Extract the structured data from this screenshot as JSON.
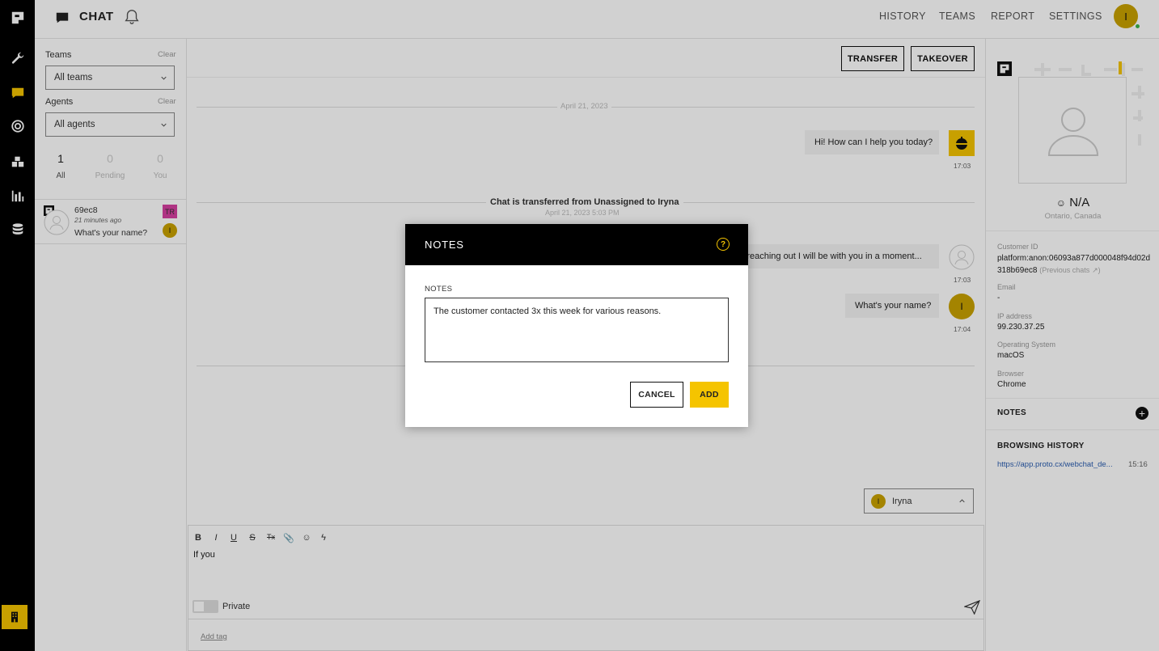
{
  "header": {
    "title": "CHAT",
    "nav": [
      "HISTORY",
      "TEAMS",
      "REPORT",
      "SETTINGS"
    ],
    "user_initial": "I"
  },
  "filters": {
    "teams_label": "Teams",
    "teams_clear": "Clear",
    "teams_value": "All teams",
    "agents_label": "Agents",
    "agents_clear": "Clear",
    "agents_value": "All agents",
    "counts": [
      {
        "value": "1",
        "label": "All"
      },
      {
        "value": "0",
        "label": "Pending"
      },
      {
        "value": "0",
        "label": "You"
      }
    ]
  },
  "chat_list": [
    {
      "name": "69ec8",
      "time": "21 minutes ago",
      "preview": "What's your name?",
      "team_badge": "TR",
      "agent_initial": "I"
    }
  ],
  "conversation": {
    "transfer_label": "TRANSFER",
    "takeover_label": "TAKEOVER",
    "date_divider": "April 21, 2023",
    "transfer_notice": "Chat is transferred from Unassigned to Iryna",
    "transfer_time": "April 21, 2023 5:03 PM",
    "messages": [
      {
        "text": "Hi! How can I help you today?",
        "time": "17:03"
      },
      {
        "text": "Thank you for reaching out I will be with you in a moment...",
        "time": "17:03"
      },
      {
        "text": "What's your name?",
        "time": "17:04"
      }
    ],
    "agent_initial": "I",
    "agent_select": "Iryna"
  },
  "composer": {
    "text": "If you",
    "private_label": "Private",
    "add_tag": "Add tag",
    "format_tools": [
      "B",
      "I",
      "U",
      "S",
      "Tx",
      "📎",
      "☺",
      "ϟ"
    ]
  },
  "customer": {
    "name": "N/A",
    "location": "Ontario, Canada",
    "customer_id_label": "Customer ID",
    "customer_id": "platform:anon:06093a877d000048f94d02d318b69ec8",
    "previous_chats": "(Previous chats",
    "email_label": "Email",
    "email": "-",
    "ip_label": "IP address",
    "ip": "99.230.37.25",
    "os_label": "Operating System",
    "os": "macOS",
    "browser_label": "Browser",
    "browser": "Chrome",
    "notes_label": "NOTES",
    "history_label": "BROWSING HISTORY",
    "history_url": "https://app.proto.cx/webchat_de...",
    "history_time": "15:16"
  },
  "modal": {
    "title": "NOTES",
    "field_label": "NOTES",
    "value": "The customer contacted 3x this week for various reasons.",
    "cancel_label": "CANCEL",
    "add_label": "ADD"
  },
  "colors": {
    "accent": "#f5c400",
    "rail": "#000000",
    "badge": "#d63fa0"
  }
}
